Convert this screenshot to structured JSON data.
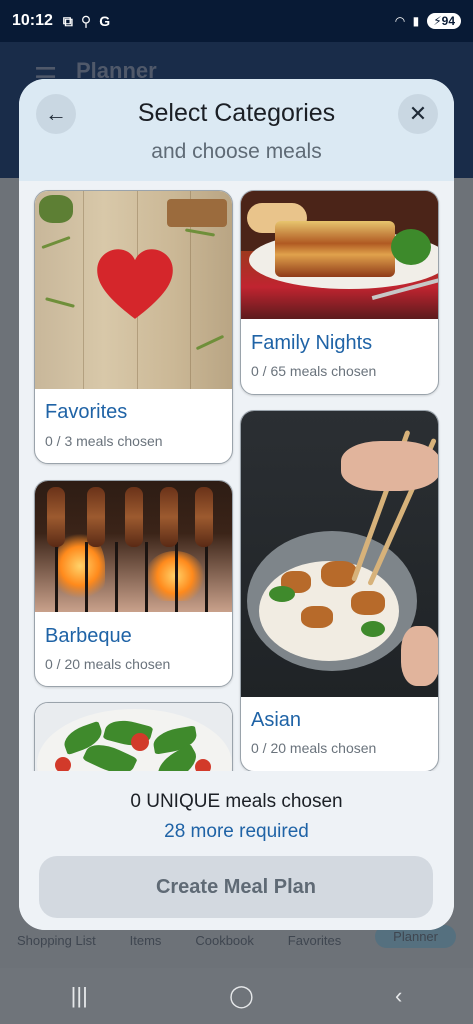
{
  "status_bar": {
    "time": "10:12",
    "icons": [
      "screenshot-icon",
      "usb-icon",
      "google-icon"
    ],
    "right_icons": [
      "wifi-6e-icon",
      "signal-icon"
    ],
    "battery": "94"
  },
  "background_app": {
    "title": "Planner",
    "bottom_nav": [
      "Shopping List",
      "Items",
      "Cookbook",
      "Favorites",
      "Planner"
    ]
  },
  "modal": {
    "title": "Select Categories",
    "subtitle": "and choose meals",
    "categories": [
      {
        "name": "Favorites",
        "count": "0 / 3 meals chosen"
      },
      {
        "name": "Family Nights",
        "count": "0 / 65 meals chosen"
      },
      {
        "name": "Barbeque",
        "count": "0 / 20 meals chosen"
      },
      {
        "name": "Asian",
        "count": "0 / 20 meals chosen"
      },
      {
        "name": "",
        "count": ""
      }
    ],
    "summary": "0 UNIQUE meals chosen",
    "required": "28 more required",
    "create_button": "Create Meal Plan"
  },
  "colors": {
    "accent": "#1f63a6",
    "header_bg": "#dbe9f3",
    "button_disabled_bg": "#d3d9e0"
  }
}
